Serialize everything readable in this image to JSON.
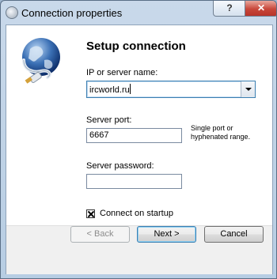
{
  "window": {
    "title": "Connection properties",
    "help_label": "?",
    "close_label": "✕"
  },
  "main": {
    "heading": "Setup connection",
    "server_name_label": "IP or server name:",
    "server_name_value": "ircworld.ru",
    "server_port_label": "Server port:",
    "server_port_value": "6667",
    "port_hint": "Single port or hyphenated range.",
    "password_label": "Server password:",
    "password_value": "",
    "connect_on_startup_label": "Connect on startup",
    "connect_on_startup_checked": true
  },
  "footer": {
    "back_label": "< Back",
    "next_label": "Next >",
    "cancel_label": "Cancel"
  },
  "icons": [
    "window-app-icon",
    "globe-network-icon",
    "dropdown-arrow-icon",
    "checkbox-checked-icon"
  ],
  "colors": {
    "accent": "#3c7fb1",
    "close_button": "#c8473a"
  }
}
